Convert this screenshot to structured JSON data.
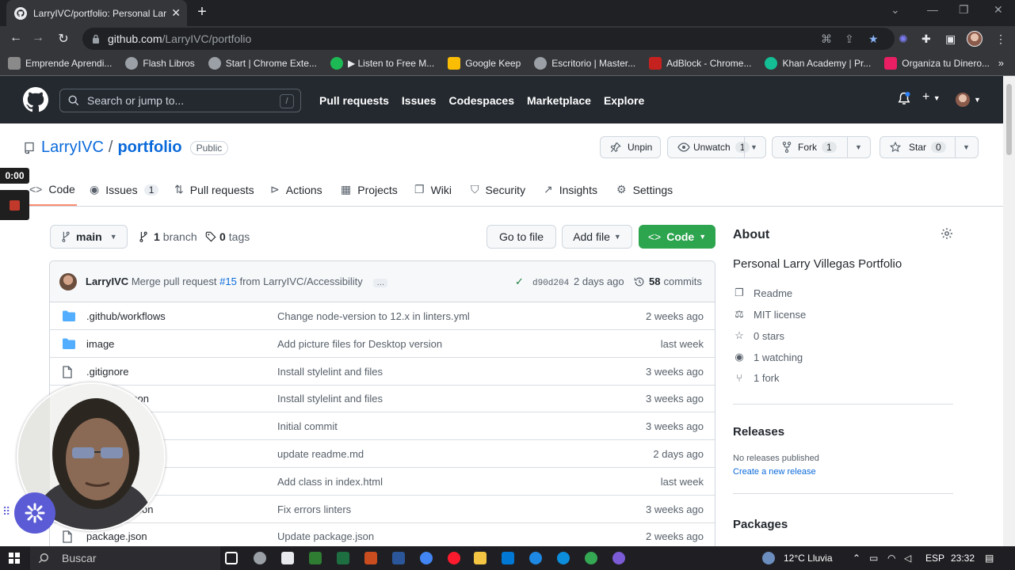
{
  "browser": {
    "tab_title": "LarryIVC/portfolio: Personal Larr",
    "url_domain": "github.com",
    "url_path": "/LarryIVC/portfolio",
    "bookmarks": [
      {
        "label": "Emprende Aprendi...",
        "color": "#8a8a8a"
      },
      {
        "label": "Flash Libros",
        "color": "#9aa0a6"
      },
      {
        "label": "Start | Chrome Exte...",
        "color": "#9aa0a6"
      },
      {
        "label": "▶ Listen to Free M...",
        "color": "#1db954"
      },
      {
        "label": "Google Keep",
        "color": "#fbbc04"
      },
      {
        "label": "Escritorio | Master...",
        "color": "#9aa0a6"
      },
      {
        "label": "AdBlock - Chrome...",
        "color": "#c5221f"
      },
      {
        "label": "Khan Academy | Pr...",
        "color": "#14bf96"
      },
      {
        "label": "Organiza tu Dinero...",
        "color": "#e91e63"
      }
    ]
  },
  "github": {
    "search_placeholder": "Search or jump to...",
    "search_shortcut": "/",
    "nav": [
      "Pull requests",
      "Issues",
      "Codespaces",
      "Marketplace",
      "Explore"
    ]
  },
  "repo": {
    "owner": "LarryIVC",
    "slash": "/",
    "name": "portfolio",
    "visibility": "Public",
    "unpin": "Unpin",
    "unwatch": "Unwatch",
    "watch_count": "1",
    "fork": "Fork",
    "fork_count": "1",
    "star": "Star",
    "star_count": "0"
  },
  "tabs": {
    "code": "Code",
    "issues": "Issues",
    "issues_count": "1",
    "pulls": "Pull requests",
    "actions": "Actions",
    "projects": "Projects",
    "wiki": "Wiki",
    "security": "Security",
    "insights": "Insights",
    "settings": "Settings"
  },
  "toolbar": {
    "branch": "main",
    "branch_count": "1",
    "branch_label": "branch",
    "tag_count": "0",
    "tag_label": "tags",
    "go_to_file": "Go to file",
    "add_file": "Add file",
    "code": "Code"
  },
  "commit": {
    "author": "LarryIVC",
    "message_pre": "Merge pull request",
    "pr": "#15",
    "message_post": "from LarryIVC/Accessibility",
    "ellipsis": "…",
    "sha": "d90d204",
    "age": "2 days ago",
    "commits_count": "58",
    "commits_label": "commits"
  },
  "files": [
    {
      "name": ".github/workflows",
      "type": "dir",
      "message": "Change node-version to 12.x in linters.yml",
      "age": "2 weeks ago"
    },
    {
      "name": "image",
      "type": "dir",
      "message": "Add picture files for Desktop version",
      "age": "last week"
    },
    {
      "name": ".gitignore",
      "type": "file",
      "message": "Install stylelint and files",
      "age": "3 weeks ago"
    },
    {
      "name": "",
      "name_tail": "son",
      "type": "file",
      "message": "Install stylelint and files",
      "age": "3 weeks ago"
    },
    {
      "name": "",
      "type": "file",
      "message": "Initial commit",
      "age": "3 weeks ago"
    },
    {
      "name": "",
      "type": "file",
      "message": "update readme.md",
      "age": "2 days ago"
    },
    {
      "name": "",
      "type": "file",
      "message": "Add class in index.html",
      "age": "last week"
    },
    {
      "name": "",
      "name_tail": ".json",
      "type": "file",
      "message": "Fix errors linters",
      "age": "3 weeks ago"
    },
    {
      "name": "package.json",
      "type": "file",
      "message": "Update package.json",
      "age": "2 weeks ago"
    }
  ],
  "about": {
    "title": "About",
    "description": "Personal Larry Villegas Portfolio",
    "readme": "Readme",
    "license": "MIT license",
    "stars": "0 stars",
    "watching": "1 watching",
    "forks": "1 fork"
  },
  "releases": {
    "title": "Releases",
    "none": "No releases published",
    "create": "Create a new release"
  },
  "packages": {
    "title": "Packages"
  },
  "recording": {
    "timer": "0:00"
  },
  "taskbar": {
    "search": "Buscar",
    "weather": "12°C  Lluvia",
    "lang": "ESP",
    "time": "23:32"
  }
}
